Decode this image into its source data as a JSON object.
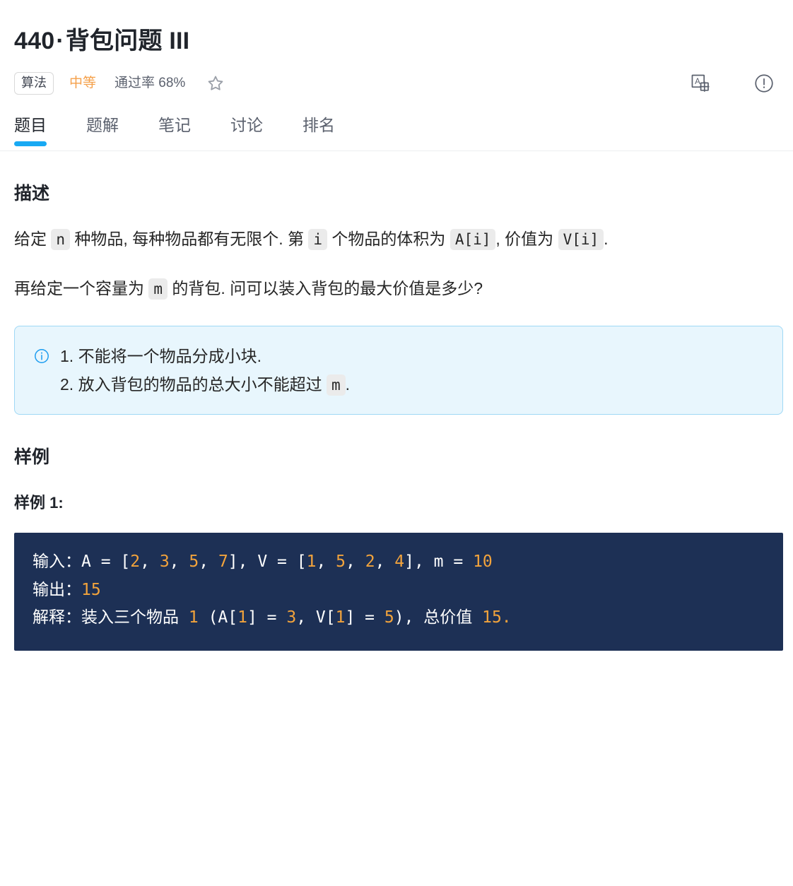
{
  "header": {
    "problem_number": "440",
    "separator": "·",
    "title_cn": "背包问题",
    "title_roman": "III",
    "category_tag": "算法",
    "difficulty": "中等",
    "accept_rate": "通过率 68%",
    "star_icon": "star-outline-icon",
    "translate_icon": "translate-icon",
    "report_icon": "exclamation-circle-icon",
    "accent_color": "#18a9f3",
    "difficulty_color": "#f5a04a"
  },
  "tabs": [
    {
      "label": "题目",
      "active": true
    },
    {
      "label": "题解",
      "active": false
    },
    {
      "label": "笔记",
      "active": false
    },
    {
      "label": "讨论",
      "active": false
    },
    {
      "label": "排名",
      "active": false
    }
  ],
  "description": {
    "heading": "描述",
    "paragraph1": {
      "t1": "给定 ",
      "c1": "n",
      "t2": " 种物品, 每种物品都有无限个. 第 ",
      "c2": "i",
      "t3": " 个物品的体积为 ",
      "c3": "A[i]",
      "t4": ", 价值为 ",
      "c4": "V[i]",
      "t5": "."
    },
    "paragraph2": {
      "t1": "再给定一个容量为 ",
      "c1": "m",
      "t2": " 的背包. 问可以装入背包的最大价值是多少?"
    }
  },
  "notice": {
    "icon": "info-circle-icon",
    "background_color": "#e8f6fd",
    "border_color": "#9fd8f5",
    "items": [
      {
        "t1": "不能将一个物品分成小块.",
        "c1": "",
        "t2": ""
      },
      {
        "t1": "放入背包的物品的总大小不能超过 ",
        "c1": "m",
        "t2": "."
      }
    ]
  },
  "examples": {
    "heading": "样例",
    "example1_heading": "样例 1:",
    "code_background": "#1d3055",
    "number_color": "#f2a33c",
    "lines": [
      {
        "segments": [
          {
            "text": "输入：A = [",
            "type": "plain"
          },
          {
            "text": "2",
            "type": "num"
          },
          {
            "text": ", ",
            "type": "plain"
          },
          {
            "text": "3",
            "type": "num"
          },
          {
            "text": ", ",
            "type": "plain"
          },
          {
            "text": "5",
            "type": "num"
          },
          {
            "text": ", ",
            "type": "plain"
          },
          {
            "text": "7",
            "type": "num"
          },
          {
            "text": "], V = [",
            "type": "plain"
          },
          {
            "text": "1",
            "type": "num"
          },
          {
            "text": ", ",
            "type": "plain"
          },
          {
            "text": "5",
            "type": "num"
          },
          {
            "text": ", ",
            "type": "plain"
          },
          {
            "text": "2",
            "type": "num"
          },
          {
            "text": ", ",
            "type": "plain"
          },
          {
            "text": "4",
            "type": "num"
          },
          {
            "text": "], m = ",
            "type": "plain"
          },
          {
            "text": "10",
            "type": "num"
          }
        ]
      },
      {
        "segments": [
          {
            "text": "输出：",
            "type": "plain"
          },
          {
            "text": "15",
            "type": "num"
          }
        ]
      },
      {
        "segments": [
          {
            "text": "解释：装入三个物品 ",
            "type": "plain"
          },
          {
            "text": "1",
            "type": "num"
          },
          {
            "text": " (A[",
            "type": "plain"
          },
          {
            "text": "1",
            "type": "num"
          },
          {
            "text": "] = ",
            "type": "plain"
          },
          {
            "text": "3",
            "type": "num"
          },
          {
            "text": ", V[",
            "type": "plain"
          },
          {
            "text": "1",
            "type": "num"
          },
          {
            "text": "] = ",
            "type": "plain"
          },
          {
            "text": "5",
            "type": "num"
          },
          {
            "text": "), 总价值 ",
            "type": "plain"
          },
          {
            "text": "15.",
            "type": "num"
          }
        ]
      }
    ]
  }
}
